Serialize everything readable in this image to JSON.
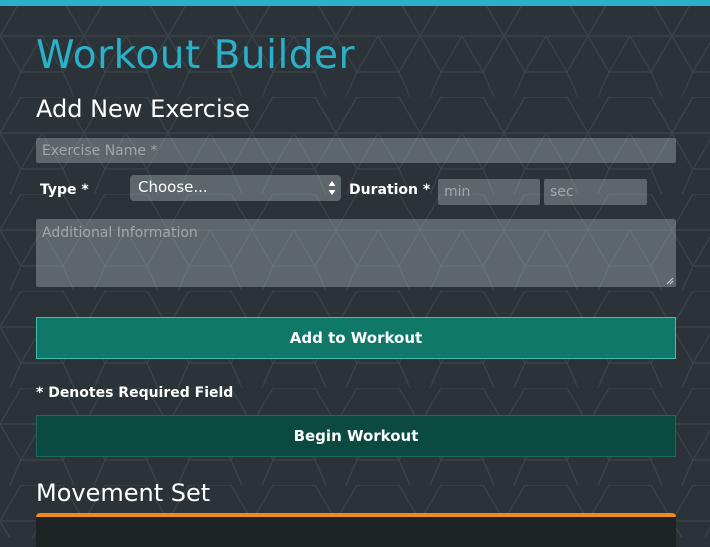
{
  "app": {
    "title": "Workout Builder"
  },
  "add_exercise": {
    "heading": "Add New Exercise",
    "exercise_name_placeholder": "Exercise Name *",
    "type_label": "Type *",
    "type_selected": "Choose...",
    "duration_label": "Duration *",
    "min_placeholder": "min",
    "sec_placeholder": "sec",
    "additional_info_placeholder": "Additional Information",
    "add_button_label": "Add to Workout",
    "required_note": "* Denotes Required Field",
    "begin_button_label": "Begin Workout"
  },
  "movement_set": {
    "heading": "Movement Set"
  },
  "theme": {
    "background": "#2b3338",
    "pattern_line": "#3a4449",
    "accent_teal": "#2ab0c8",
    "add_button": "#0f7868",
    "add_button_border": "#3fc0b0",
    "begin_button": "#0b4a40",
    "begin_button_border": "#1f6a5e",
    "movement_accent": "#f08a1c"
  },
  "icons": {
    "select_arrows": "up-down-arrows-icon",
    "resize_grip": "resize-grip-icon"
  }
}
